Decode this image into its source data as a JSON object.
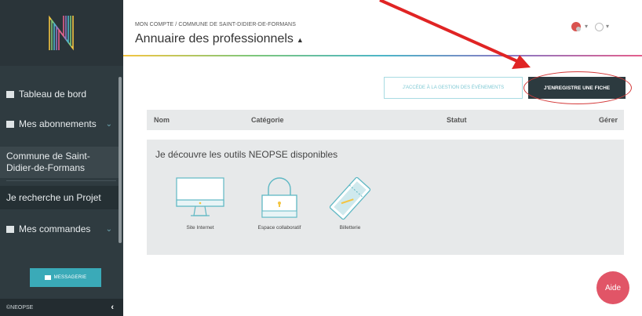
{
  "sidebar": {
    "items": [
      {
        "label": "Tableau de bord"
      },
      {
        "label": "Mes abonnements"
      },
      {
        "label": "Commune de Saint-Didier-de-Formans"
      },
      {
        "label": "Je recherche un Projet"
      },
      {
        "label": "Mes commandes"
      }
    ],
    "messagerie_label": "MESSAGERIE",
    "footer_label": "©NEOPSE"
  },
  "header": {
    "breadcrumb": "MON COMPTE / COMMUNE DE SAINT-DIDIER-DE-FORMANS",
    "title": "Annuaire des professionnels"
  },
  "actions": {
    "events_label": "J'ACCÈDE À LA GESTION DES ÉVÉNEMENTS",
    "fiche_label": "J'ENREGISTRE UNE FICHE"
  },
  "table": {
    "columns": [
      "Nom",
      "Catégorie",
      "Statut",
      "Gérer"
    ]
  },
  "tools": {
    "title": "Je découvre les outils NEOPSE disponibles",
    "items": [
      {
        "label": "Site Internet",
        "icon": "monitor-icon"
      },
      {
        "label": "Espace collaboratif",
        "icon": "padlock-icon"
      },
      {
        "label": "Billetterie",
        "icon": "ticket-icon"
      }
    ]
  },
  "aide_label": "Aide",
  "colors": {
    "sidebar_bg": "#2f3b40",
    "accent_teal": "#3aaab8",
    "dark_button": "#2c3a3f",
    "aide_red": "#e15567",
    "annotation_red": "#d43a3a"
  }
}
